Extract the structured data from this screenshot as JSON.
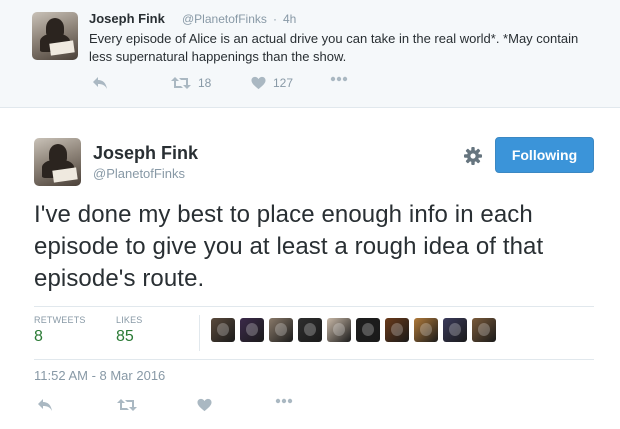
{
  "parent_tweet": {
    "author_name": "Joseph Fink",
    "handle": "@PlanetofFinks",
    "separator": "·",
    "time": "4h",
    "text": "Every episode of Alice is an actual drive you can take in the real world*. *May contain less supernatural happenings than the show.",
    "actions": {
      "reply_icon": "reply-icon",
      "retweet_icon": "retweet-icon",
      "retweet_count": "18",
      "like_icon": "heart-icon",
      "like_count": "127",
      "more_icon": "more-icon"
    }
  },
  "main_tweet": {
    "author_name": "Joseph Fink",
    "handle": "@PlanetofFinks",
    "settings_icon": "gear-icon",
    "follow_button_label": "Following",
    "text": "I've done my best to place enough info in each episode to give you at least a rough idea of that episode's route.",
    "stats": {
      "retweets_label": "RETWEETS",
      "retweets_value": "8",
      "likes_label": "LIKES",
      "likes_value": "85"
    },
    "timestamp": "11:52 AM - 8 Mar 2016",
    "actions": {
      "reply_icon": "reply-icon",
      "retweet_icon": "retweet-icon",
      "like_icon": "heart-icon",
      "more_icon": "more-icon"
    }
  },
  "colors": {
    "follow_button": "#3b94d9",
    "stat_value": "#2a7a35",
    "muted_text": "#8899a6",
    "icon_gray": "#aab8c2",
    "parent_background": "#f5f8fa"
  },
  "liker_avatars": [
    "#5a4a3c",
    "#3b2a4a",
    "#8a7a6a",
    "#2e2e2e",
    "#c9b9a8",
    "#1e1e1e",
    "#6a3a1a",
    "#b07a3a",
    "#3a3a5a",
    "#7a5a3a"
  ]
}
